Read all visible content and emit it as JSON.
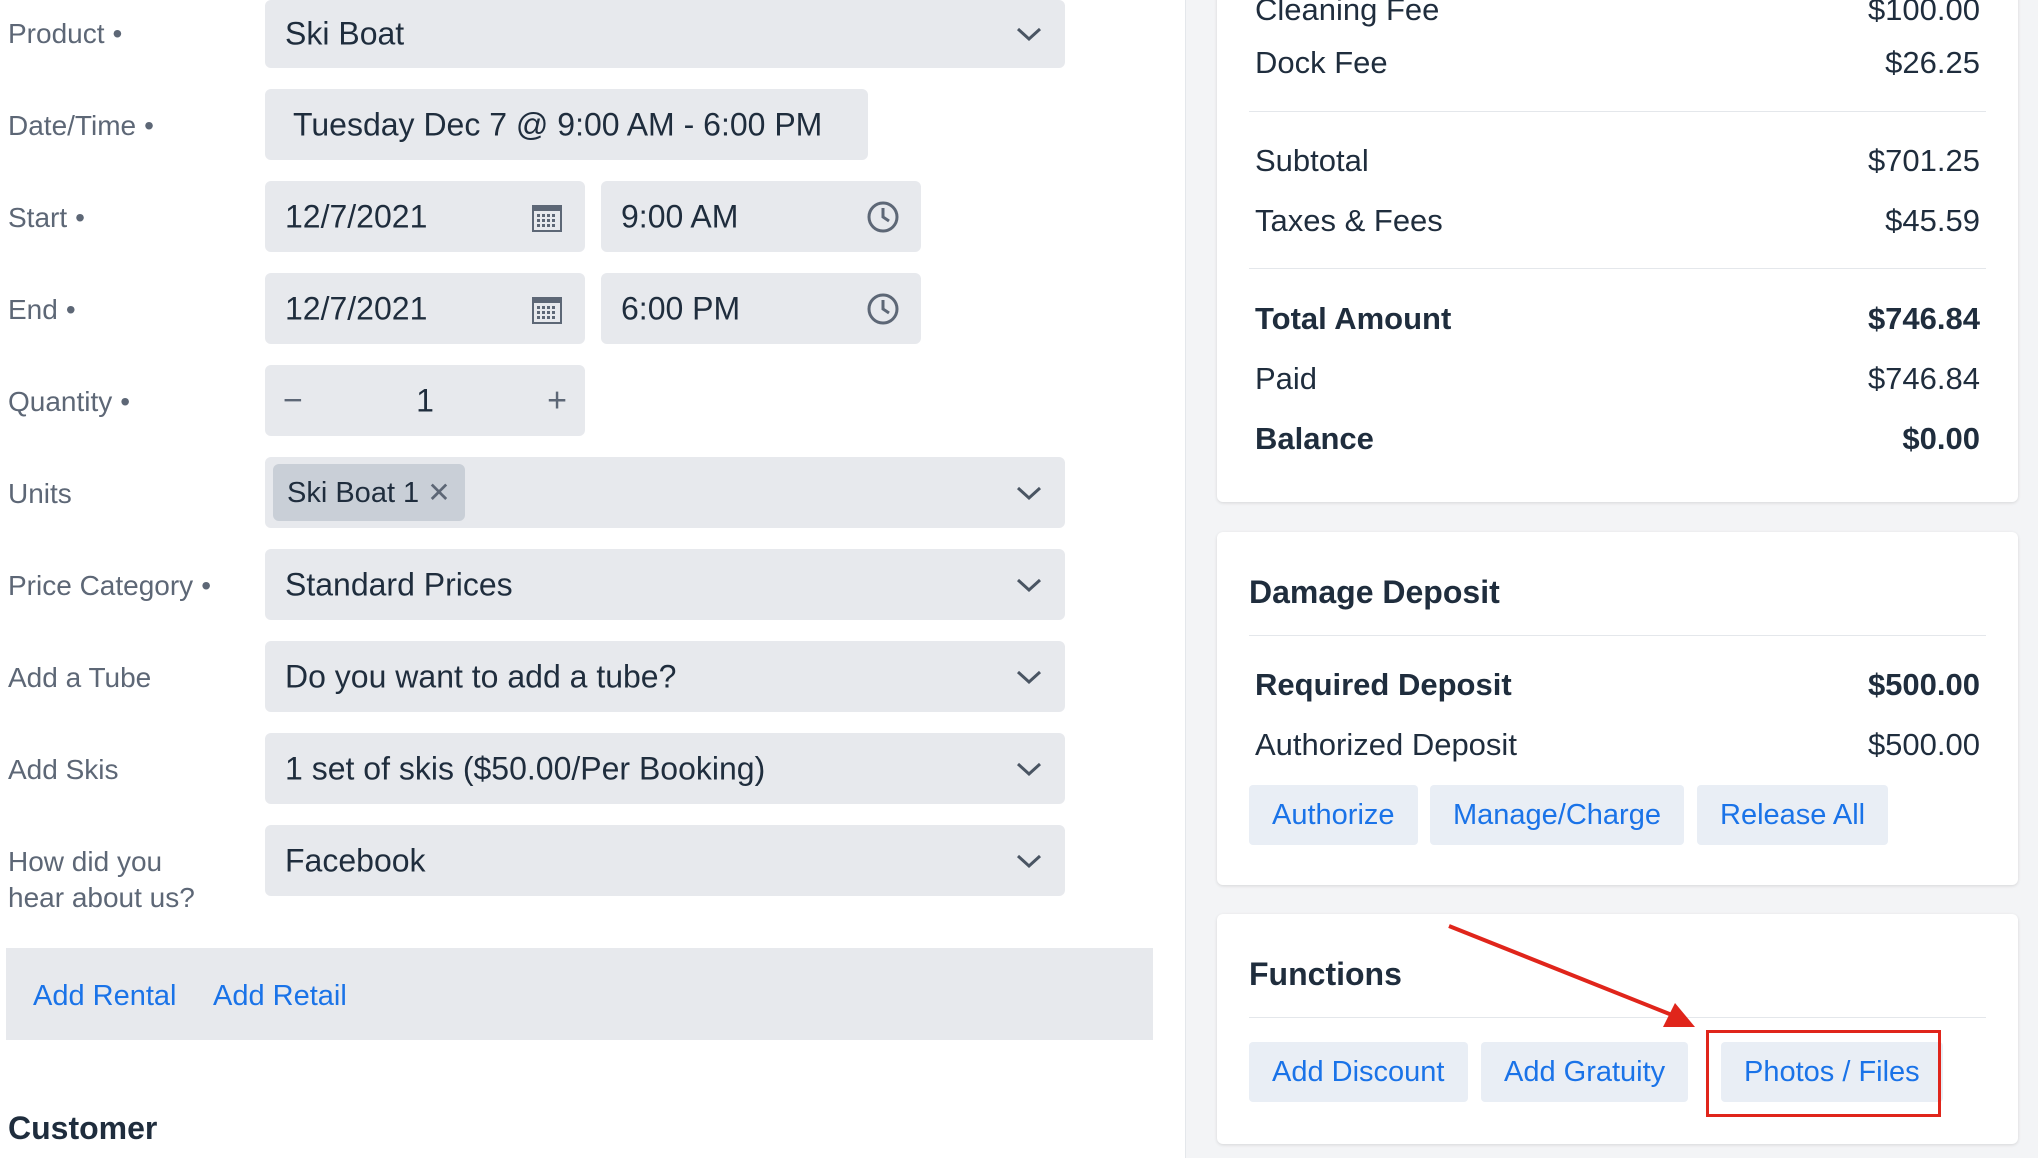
{
  "form": {
    "product": {
      "label": "Product",
      "value": "Ski Boat"
    },
    "datetime": {
      "label": "Date/Time",
      "value": "Tuesday Dec 7 @ 9:00 AM - 6:00 PM"
    },
    "start": {
      "label": "Start",
      "date": "12/7/2021",
      "time": "9:00 AM"
    },
    "end": {
      "label": "End",
      "date": "12/7/2021",
      "time": "6:00 PM"
    },
    "quantity": {
      "label": "Quantity",
      "value": "1",
      "minus": "−",
      "plus": "+"
    },
    "units": {
      "label": "Units",
      "chip": "Ski Boat 1",
      "chip_remove": "✕"
    },
    "price_category": {
      "label": "Price Category",
      "value": "Standard Prices"
    },
    "add_tube": {
      "label": "Add a Tube",
      "value": "Do you want to add a tube?"
    },
    "add_skis": {
      "label": "Add Skis",
      "value": "1 set of skis ($50.00/Per Booking)"
    },
    "hear_about": {
      "label_line1": "How did you",
      "label_line2": "hear about us?",
      "value": "Facebook"
    },
    "required_marker": "•"
  },
  "actions": {
    "add_rental": "Add Rental",
    "add_retail": "Add Retail"
  },
  "customer_heading": "Customer",
  "summary": {
    "cleaning_fee": {
      "label": "Cleaning Fee",
      "value": "$100.00"
    },
    "dock_fee": {
      "label": "Dock Fee",
      "value": "$26.25"
    },
    "subtotal": {
      "label": "Subtotal",
      "value": "$701.25"
    },
    "taxes": {
      "label": "Taxes & Fees",
      "value": "$45.59"
    },
    "total": {
      "label": "Total Amount",
      "value": "$746.84"
    },
    "paid": {
      "label": "Paid",
      "value": "$746.84"
    },
    "balance": {
      "label": "Balance",
      "value": "$0.00"
    }
  },
  "damage_deposit": {
    "title": "Damage Deposit",
    "required": {
      "label": "Required Deposit",
      "value": "$500.00"
    },
    "authorized": {
      "label": "Authorized Deposit",
      "value": "$500.00"
    },
    "buttons": {
      "authorize": "Authorize",
      "manage": "Manage/Charge",
      "release": "Release All"
    }
  },
  "functions": {
    "title": "Functions",
    "buttons": {
      "discount": "Add Discount",
      "gratuity": "Add Gratuity",
      "photos": "Photos / Files"
    }
  },
  "colors": {
    "accent": "#1a73e8",
    "highlight": "#e0251b",
    "field_bg": "#e7e9ed"
  }
}
